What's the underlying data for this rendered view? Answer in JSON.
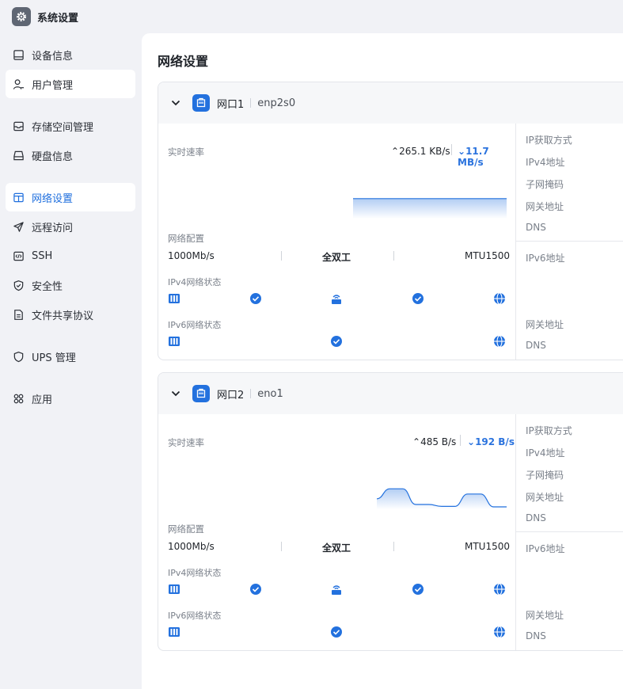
{
  "window": {
    "title": "系统设置",
    "icon": "gear-icon"
  },
  "sidebar": {
    "items": [
      {
        "label": "设备信息",
        "icon": "monitor-icon"
      },
      {
        "label": "用户管理",
        "icon": "user-icon"
      },
      {
        "label": "存储空间管理",
        "icon": "storage-icon"
      },
      {
        "label": "硬盘信息",
        "icon": "disk-icon"
      },
      {
        "label": "网络设置",
        "icon": "network-window-icon"
      },
      {
        "label": "远程访问",
        "icon": "send-icon"
      },
      {
        "label": "SSH",
        "icon": "code-icon"
      },
      {
        "label": "安全性",
        "icon": "shield-check-icon"
      },
      {
        "label": "文件共享协议",
        "icon": "document-icon"
      },
      {
        "label": "UPS 管理",
        "icon": "shield-icon"
      },
      {
        "label": "应用",
        "icon": "apps-icon"
      }
    ],
    "active_item": "网络设置"
  },
  "main": {
    "title": "网络设置",
    "ports": [
      {
        "name": "网口1",
        "device": "enp2s0",
        "speed_label": "实时速率",
        "upload": "265.1 KB/s",
        "download": "11.7 MB/s",
        "download_history": [
          0.42,
          0.42,
          0.42,
          0.42,
          0.42,
          0.42,
          0.42,
          0.42,
          0.42
        ],
        "config_label": "网络配置",
        "link_speed": "1000Mb/s",
        "duplex": "全双工",
        "mtu": "MTU1500",
        "ipv4_status_label": "IPv4网络状态",
        "ipv6_status_label": "IPv6网络状态",
        "right_labels": [
          "IP获取方式",
          "IPv4地址",
          "子网掩码",
          "网关地址",
          "DNS"
        ],
        "ipv6_labels": [
          "IPv6地址",
          "网关地址",
          "DNS"
        ]
      },
      {
        "name": "网口2",
        "device": "eno1",
        "speed_label": "实时速率",
        "upload": "485 B/s",
        "download": "192 B/s",
        "download_history": [
          0.22,
          0.43,
          0.43,
          0.1,
          0.1,
          0.06,
          0.06,
          0.32,
          0.32,
          0.05,
          0.05
        ],
        "config_label": "网络配置",
        "link_speed": "1000Mb/s",
        "duplex": "全双工",
        "mtu": "MTU1500",
        "ipv4_status_label": "IPv4网络状态",
        "ipv6_status_label": "IPv6网络状态",
        "right_labels": [
          "IP获取方式",
          "IPv4地址",
          "子网掩码",
          "网关地址",
          "DNS"
        ],
        "ipv6_labels": [
          "IPv6地址",
          "网关地址",
          "DNS"
        ]
      }
    ]
  },
  "colors": {
    "accent": "#2371de",
    "active_text": "#1f6fde",
    "sidebar_bg": "#f1f2f6"
  }
}
